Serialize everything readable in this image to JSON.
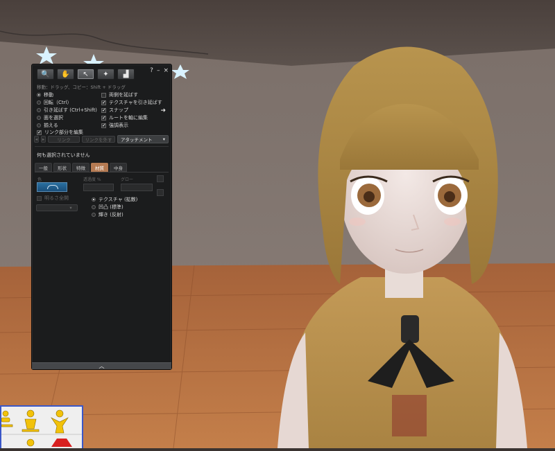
{
  "toolbar": {
    "tools": [
      {
        "icon": "magnifier-icon"
      },
      {
        "icon": "hand-icon"
      },
      {
        "icon": "edit-icon"
      },
      {
        "icon": "magic-wand-icon"
      },
      {
        "icon": "bulldozer-icon"
      }
    ],
    "help": "?",
    "minimize": "–",
    "close": "×"
  },
  "hint": "移動：ドラッグ、コピー：Shift + ドラッグ",
  "modes_left": [
    {
      "label": "移動",
      "kind": "radio",
      "on": true
    },
    {
      "label": "回転（Ctrl）",
      "kind": "radio",
      "on": false
    },
    {
      "label": "引き延ばす (Ctrl+Shift)",
      "kind": "radio",
      "on": false
    },
    {
      "label": "面を選択",
      "kind": "radio",
      "on": false
    },
    {
      "label": "揃える",
      "kind": "radio",
      "on": false
    },
    {
      "label": "リンク部分を編集",
      "kind": "check",
      "on": true
    }
  ],
  "options_right": [
    {
      "label": "両側を延ばす",
      "on": false
    },
    {
      "label": "テクスチャを引き延ばす",
      "on": true
    },
    {
      "label": "スナップ",
      "on": true
    },
    {
      "label": "ルートを軸に編集",
      "on": true
    },
    {
      "label": "強調表示",
      "on": true
    }
  ],
  "link_row": {
    "link": "リンク",
    "unlink": "リンクを外す",
    "attachment": "アタッチメント"
  },
  "status": "何も選択されていません",
  "tabs": [
    "一般",
    "形状",
    "特徴",
    "材質",
    "中身"
  ],
  "material": {
    "color_label": "色",
    "transparency_label": "透過度 %",
    "glow_label": "グロー",
    "fullbright_label": "明るさ全開",
    "map_options": [
      {
        "label": "テクスチャ (拡散)",
        "on": true
      },
      {
        "label": "凹凸 (標準)",
        "on": false
      },
      {
        "label": "輝き (反射)",
        "on": false
      }
    ]
  },
  "colors": {
    "panel_bg": "#1b1c1d",
    "tab_active": "#b57a52",
    "swatch": "#2a6fa0",
    "tray_border": "#3a57c8"
  }
}
